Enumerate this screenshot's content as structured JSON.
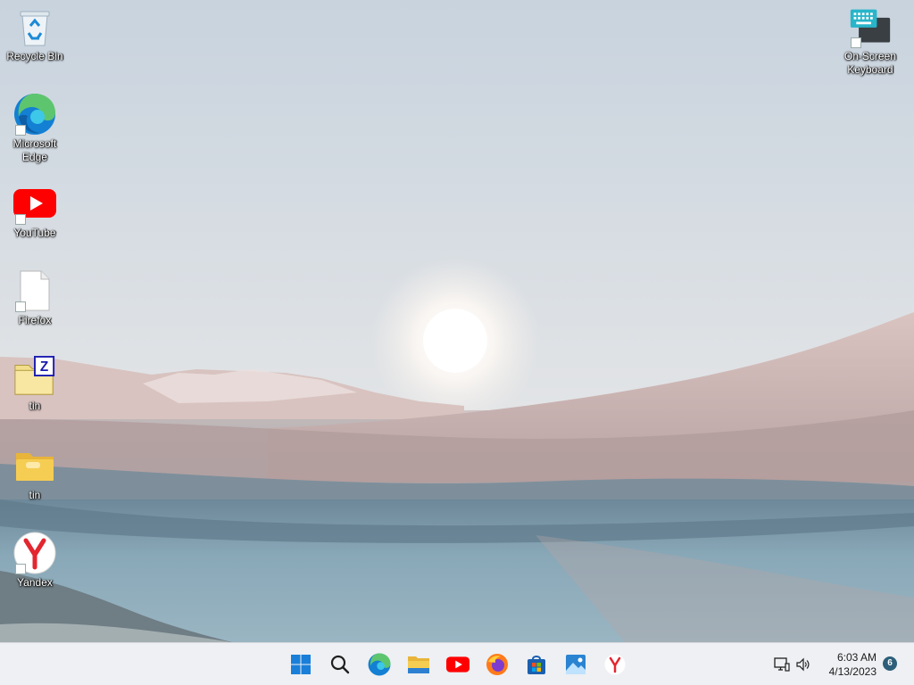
{
  "desktop": {
    "icons": [
      {
        "label": "Recycle Bin",
        "icon": "recycle-bin-icon"
      },
      {
        "label": "Microsoft\nEdge",
        "icon": "edge-icon"
      },
      {
        "label": "YouTube",
        "icon": "youtube-icon"
      },
      {
        "label": "Firefox",
        "icon": "blank-file-icon"
      },
      {
        "label": "tin",
        "icon": "zip-archive-icon"
      },
      {
        "label": "tin",
        "icon": "folder-icon"
      },
      {
        "label": "Yandex",
        "icon": "yandex-icon"
      },
      {
        "label": "On-Screen\nKeyboard",
        "icon": "keyboard-icon"
      }
    ]
  },
  "taskbar": {
    "apps": [
      "start-icon",
      "search-icon",
      "edge-icon",
      "file-explorer-icon",
      "youtube-icon",
      "firefox-icon",
      "microsoft-store-icon",
      "photos-icon",
      "yandex-icon"
    ],
    "tray": [
      "network-icon",
      "volume-icon"
    ],
    "clock": {
      "time": "6:03 AM",
      "date": "4/13/2023"
    },
    "notifications": "6"
  },
  "colors": {
    "taskbar_bg": "#eef0f3",
    "accent": "#0078d4",
    "youtube_red": "#ff0000",
    "folder_yellow": "#f4c543"
  }
}
